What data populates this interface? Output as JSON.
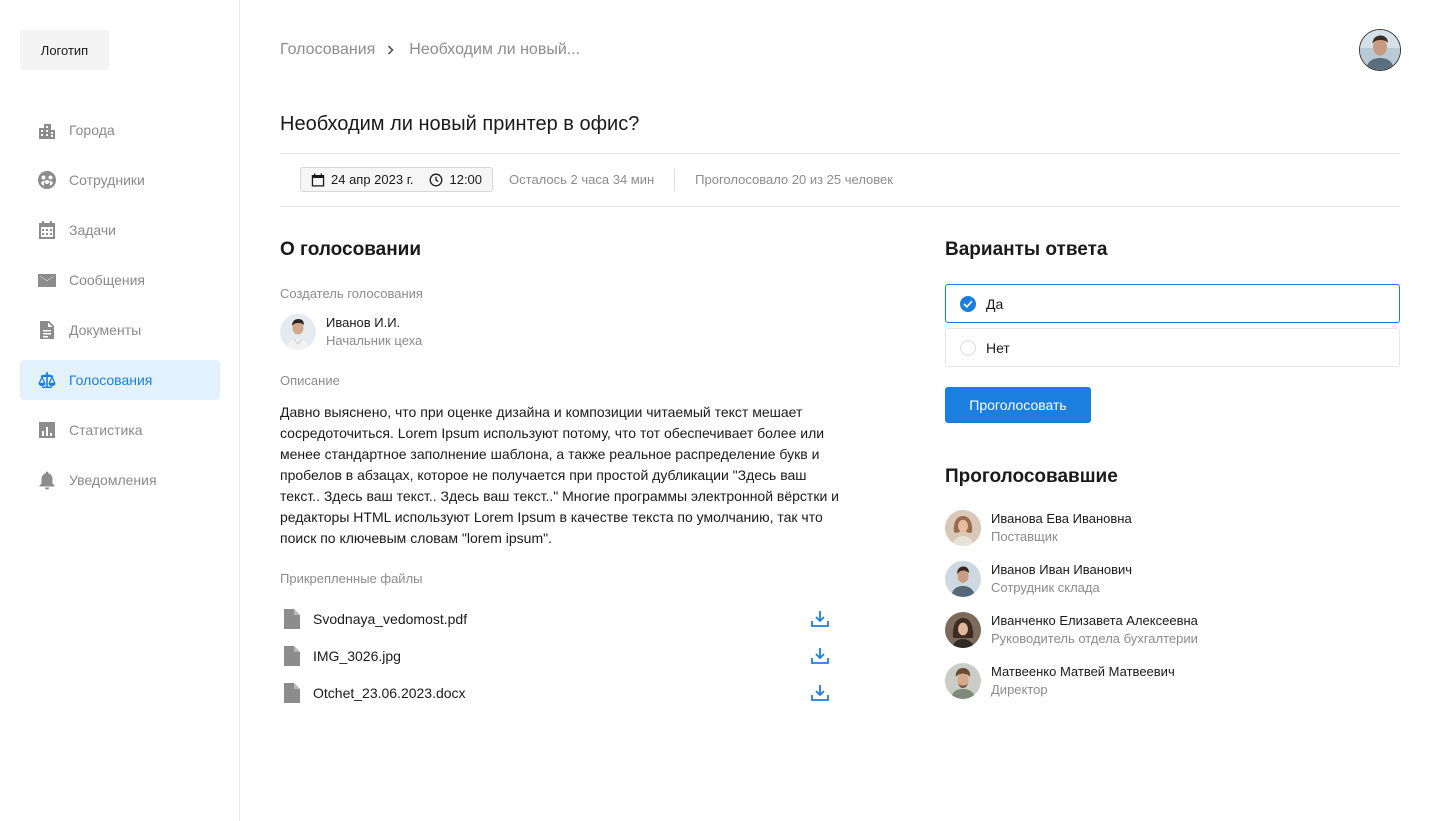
{
  "sidebar": {
    "logo": "Логотип",
    "items": [
      {
        "label": "Города",
        "icon": "city-icon"
      },
      {
        "label": "Сотрудники",
        "icon": "employees-icon"
      },
      {
        "label": "Задачи",
        "icon": "calendar-icon"
      },
      {
        "label": "Сообщения",
        "icon": "mail-icon"
      },
      {
        "label": "Документы",
        "icon": "document-icon"
      },
      {
        "label": "Голосования",
        "icon": "scales-icon",
        "active": true
      },
      {
        "label": "Статистика",
        "icon": "chart-icon"
      },
      {
        "label": "Уведомления",
        "icon": "bell-icon"
      }
    ]
  },
  "header": {
    "breadcrumb": [
      "Голосования",
      "Необходим ли новый..."
    ],
    "title": "Необходим ли новый принтер в офис?"
  },
  "meta": {
    "date": "24 апр 2023 г.",
    "time": "12:00",
    "remaining": "Осталось 2 часа 34 мин",
    "voted": "Проголосовало 20 из 25 человек"
  },
  "about": {
    "title": "О голосовании",
    "creator_label": "Создатель голосования",
    "creator_name": "Иванов И.И.",
    "creator_role": "Начальник цеха",
    "description_label": "Описание",
    "description": "Давно выяснено, что при оценке дизайна и композиции читаемый текст мешает сосредоточиться. Lorem Ipsum используют потому, что тот обеспечивает более или менее стандартное заполнение шаблона, а также реальное распределение букв и пробелов в абзацах, которое не получается при простой дубликации \"Здесь ваш текст.. Здесь ваш текст.. Здесь ваш текст..\" Многие программы электронной вёрстки и редакторы HTML используют Lorem Ipsum в качестве текста по умолчанию, так что поиск по ключевым словам \"lorem ipsum\".",
    "files_label": "Прикрепленные файлы",
    "files": [
      "Svodnaya_vedomost.pdf",
      "IMG_3026.jpg",
      "Otchet_23.06.2023.docx"
    ]
  },
  "answers": {
    "title": "Варианты ответа",
    "options": [
      {
        "label": "Да",
        "selected": true
      },
      {
        "label": "Нет",
        "selected": false
      }
    ],
    "vote_button": "Проголосовать"
  },
  "voters": {
    "title": "Проголосовавшие",
    "list": [
      {
        "name": "Иванова Ева Ивановна",
        "role": "Поставщик"
      },
      {
        "name": "Иванов Иван Иванович",
        "role": "Сотрудник склада"
      },
      {
        "name": "Иванченко Елизавета Алексеевна",
        "role": "Руководитель отдела бухгалтерии"
      },
      {
        "name": "Матвеенко Матвей Матвеевич",
        "role": "Директор"
      }
    ]
  },
  "colors": {
    "accent": "#1b7fe0",
    "active_bg": "#e3f1fd",
    "muted": "#8c8c8c"
  }
}
